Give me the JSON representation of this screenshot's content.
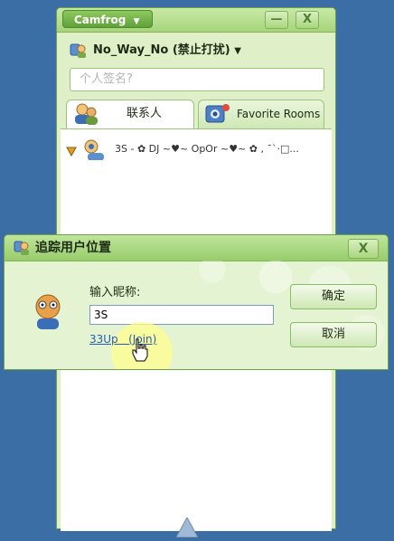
{
  "main_window": {
    "app_menu_label": "Camfrog",
    "minimize_glyph": "—",
    "close_glyph": "X",
    "user_status": "No_Way_No (禁止打扰)",
    "status_placeholder": "个人签名?",
    "tabs": [
      {
        "label": "联系人",
        "icon": "contacts-icon"
      },
      {
        "label": "Favorite Rooms",
        "icon": "rooms-icon"
      }
    ],
    "contacts": [
      {
        "name": "3S - ✿ DJ ~♥~ OpOr ~♥~ ✿ , ¯`·□..."
      }
    ]
  },
  "dialog": {
    "title": "追踪用户位置",
    "close_glyph": "X",
    "nickname_label": "输入昵称:",
    "nickname_value": "3S",
    "result_link": "33Up   (Join)",
    "ok_label": "确定",
    "cancel_label": "取消"
  },
  "colors": {
    "desktop": "#3a6ea5",
    "window_green": "#dff0c8",
    "accent_green": "#5fa13a",
    "link_blue": "#2a5db0"
  }
}
